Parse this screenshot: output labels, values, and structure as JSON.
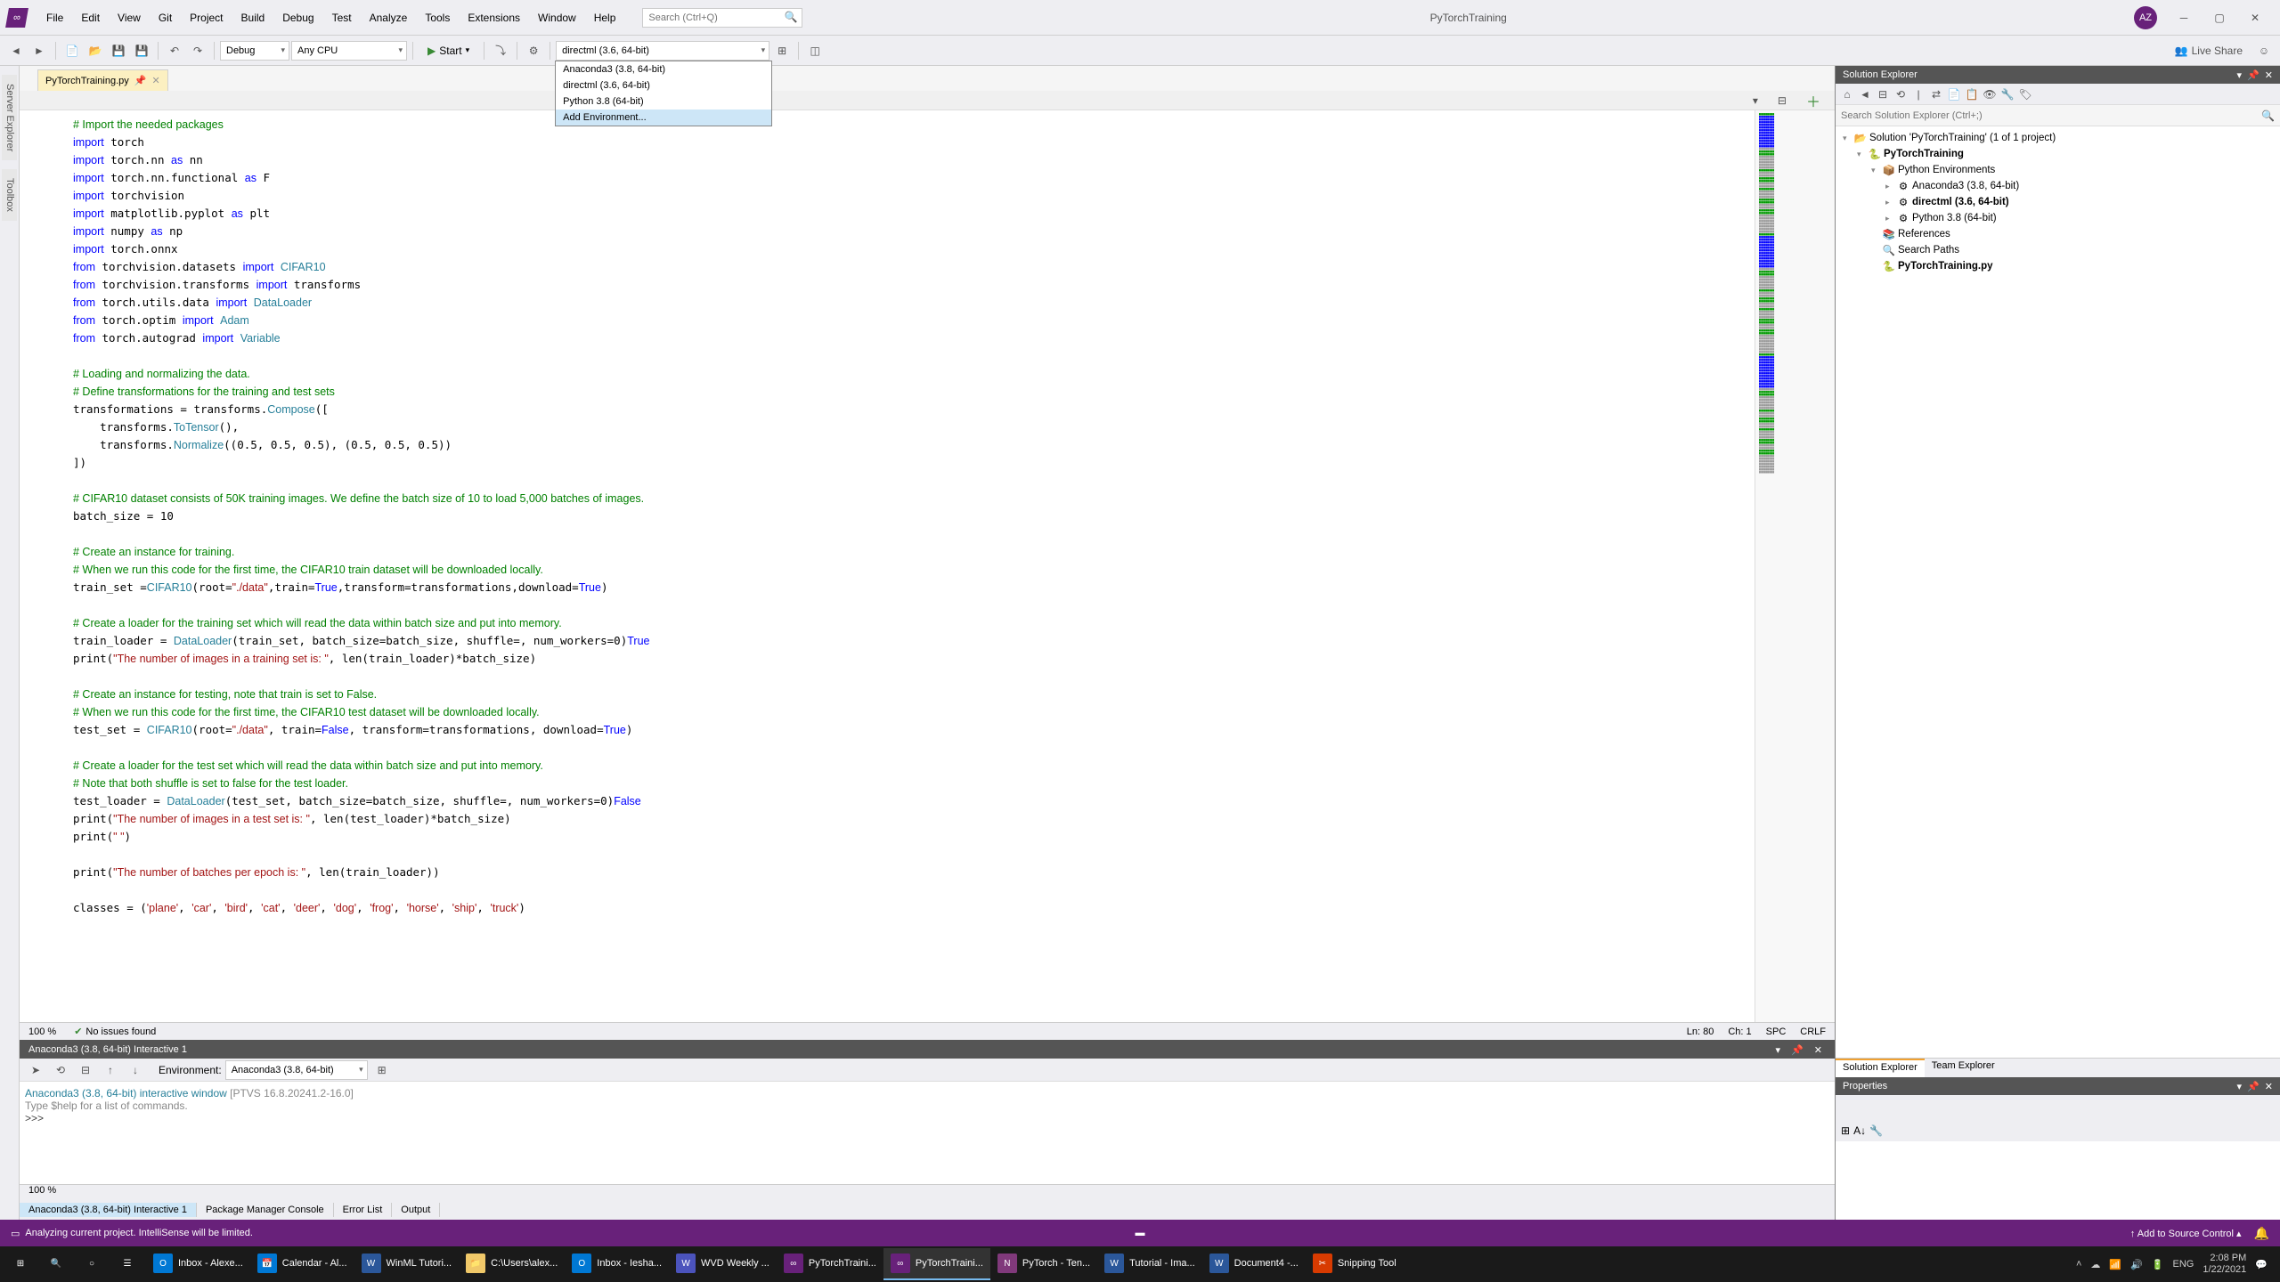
{
  "titlebar": {
    "menus": [
      "File",
      "Edit",
      "View",
      "Git",
      "Project",
      "Build",
      "Debug",
      "Test",
      "Analyze",
      "Tools",
      "Extensions",
      "Window",
      "Help"
    ],
    "search_placeholder": "Search (Ctrl+Q)",
    "solution_name": "PyTorchTraining",
    "user_initials": "AZ"
  },
  "toolbar": {
    "config": "Debug",
    "platform": "Any CPU",
    "start_label": "Start",
    "env_selected": "directml (3.6, 64-bit)",
    "env_options": [
      "Anaconda3 (3.8, 64-bit)",
      "directml (3.6, 64-bit)",
      "Python 3.8 (64-bit)",
      "Add Environment..."
    ],
    "live_share": "Live Share"
  },
  "left_tabs": [
    "Server Explorer",
    "Toolbox"
  ],
  "file_tab": {
    "name": "PyTorchTraining.py"
  },
  "code_lines": [
    {
      "t": "comment",
      "s": "# Import the needed packages"
    },
    {
      "t": "kw",
      "s": "import",
      "r": " torch"
    },
    {
      "t": "kw",
      "s": "import",
      "r": " torch.nn ",
      "kw2": "as",
      "r2": " nn"
    },
    {
      "t": "kw",
      "s": "import",
      "r": " torch.nn.functional ",
      "kw2": "as",
      "r2": " F"
    },
    {
      "t": "kw",
      "s": "import",
      "r": " torchvision"
    },
    {
      "t": "kw",
      "s": "import",
      "r": " matplotlib.pyplot ",
      "kw2": "as",
      "r2": " plt"
    },
    {
      "t": "kw",
      "s": "import",
      "r": " numpy ",
      "kw2": "as",
      "r2": " np"
    },
    {
      "t": "kw",
      "s": "import",
      "r": " torch.onnx"
    },
    {
      "t": "from",
      "s": "from",
      "m": " torchvision.datasets ",
      "kw2": "import",
      "r2": " ",
      "ty": "CIFAR10"
    },
    {
      "t": "from",
      "s": "from",
      "m": " torchvision.transforms ",
      "kw2": "import",
      "r2": " transforms"
    },
    {
      "t": "from",
      "s": "from",
      "m": " torch.utils.data ",
      "kw2": "import",
      "r2": " ",
      "ty": "DataLoader"
    },
    {
      "t": "from",
      "s": "from",
      "m": " torch.optim ",
      "kw2": "import",
      "r2": " ",
      "ty": "Adam"
    },
    {
      "t": "from",
      "s": "from",
      "m": " torch.autograd ",
      "kw2": "import",
      "r2": " ",
      "ty": "Variable"
    },
    {
      "t": "blank"
    },
    {
      "t": "comment",
      "s": "# Loading and normalizing the data."
    },
    {
      "t": "comment",
      "s": "# Define transformations for the training and test sets"
    },
    {
      "t": "assign",
      "l": "transformations = transforms.",
      "f": "Compose",
      "r": "(["
    },
    {
      "t": "indent",
      "l": "    transforms.",
      "f": "ToTensor",
      "r": "(),"
    },
    {
      "t": "indent",
      "l": "    transforms.",
      "f": "Normalize",
      "r": "((0.5, 0.5, 0.5), (0.5, 0.5, 0.5))"
    },
    {
      "t": "plain",
      "s": "])"
    },
    {
      "t": "blank"
    },
    {
      "t": "comment",
      "s": "# CIFAR10 dataset consists of 50K training images. We define the batch size of 10 to load 5,000 batches of images."
    },
    {
      "t": "plain",
      "s": "batch_size = 10"
    },
    {
      "t": "blank"
    },
    {
      "t": "comment",
      "s": "# Create an instance for training."
    },
    {
      "t": "comment",
      "s": "# When we run this code for the first time, the CIFAR10 train dataset will be downloaded locally."
    },
    {
      "t": "mixed",
      "s": "train_set =",
      "ty": "CIFAR10",
      "r": "(root=",
      "st": "\"./data\"",
      "r2": ",train=",
      "kw": "True",
      "r3": ",transform=transformations,download=",
      "kw2": "True",
      "r4": ")"
    },
    {
      "t": "blank"
    },
    {
      "t": "comment",
      "s": "# Create a loader for the training set which will read the data within batch size and put into memory."
    },
    {
      "t": "mixed",
      "s": "train_loader = ",
      "ty": "DataLoader",
      "r": "(train_set, batch_size=batch_size, shuffle=",
      "kw": "True",
      "r2": ", num_workers=0)"
    },
    {
      "t": "print",
      "s": "print(",
      "st": "\"The number of images in a training set is: \"",
      "r": ", len(train_loader)*batch_size)"
    },
    {
      "t": "blank"
    },
    {
      "t": "comment",
      "s": "# Create an instance for testing, note that train is set to False."
    },
    {
      "t": "comment",
      "s": "# When we run this code for the first time, the CIFAR10 test dataset will be downloaded locally."
    },
    {
      "t": "mixed",
      "s": "test_set = ",
      "ty": "CIFAR10",
      "r": "(root=",
      "st": "\"./data\"",
      "r2": ", train=",
      "kw": "False",
      "r3": ", transform=transformations, download=",
      "kw2": "True",
      "r4": ")"
    },
    {
      "t": "blank"
    },
    {
      "t": "comment",
      "s": "# Create a loader for the test set which will read the data within batch size and put into memory."
    },
    {
      "t": "comment",
      "s": "# Note that both shuffle is set to false for the test loader."
    },
    {
      "t": "mixed",
      "s": "test_loader = ",
      "ty": "DataLoader",
      "r": "(test_set, batch_size=batch_size, shuffle=",
      "kw": "False",
      "r2": ", num_workers=0)"
    },
    {
      "t": "print",
      "s": "print(",
      "st": "\"The number of images in a test set is: \"",
      "r": ", len(test_loader)*batch_size)"
    },
    {
      "t": "print",
      "s": "print(",
      "st": "\" \"",
      "r": ")"
    },
    {
      "t": "blank"
    },
    {
      "t": "print",
      "s": "print(",
      "st": "\"The number of batches per epoch is: \"",
      "r": ", len(train_loader))"
    },
    {
      "t": "blank"
    },
    {
      "t": "classes",
      "s": "classes = (",
      "items": [
        "'plane'",
        "'car'",
        "'bird'",
        "'cat'",
        "'deer'",
        "'dog'",
        "'frog'",
        "'horse'",
        "'ship'",
        "'truck'"
      ],
      "r": ")"
    }
  ],
  "code_footer": {
    "zoom": "100 %",
    "issues": "No issues found",
    "ln": "Ln: 80",
    "ch": "Ch: 1",
    "spc": "SPC",
    "crlf": "CRLF"
  },
  "interactive": {
    "header": "Anaconda3 (3.8, 64-bit) Interactive 1",
    "env_label": "Environment:",
    "env_value": "Anaconda3 (3.8, 64-bit)",
    "line1_a": "Anaconda3 (3.8, 64-bit) interactive window",
    "line1_b": " [PTVS 16.8.20241.2-16.0]",
    "line2": "Type $help for a list of commands.",
    "prompt": ">>>",
    "zoom": "100 %"
  },
  "bottom_tabs": [
    "Anaconda3 (3.8, 64-bit) Interactive 1",
    "Package Manager Console",
    "Error List",
    "Output"
  ],
  "solution_explorer": {
    "title": "Solution Explorer",
    "search_placeholder": "Search Solution Explorer (Ctrl+;)",
    "root": "Solution 'PyTorchTraining' (1 of 1 project)",
    "project": "PyTorchTraining",
    "env_header": "Python Environments",
    "envs": [
      "Anaconda3 (3.8, 64-bit)",
      "directml (3.6, 64-bit)",
      "Python 3.8 (64-bit)"
    ],
    "references": "References",
    "search_paths": "Search Paths",
    "file": "PyTorchTraining.py",
    "tabs": [
      "Solution Explorer",
      "Team Explorer"
    ]
  },
  "properties": {
    "title": "Properties"
  },
  "statusbar": {
    "msg": "Analyzing current project. IntelliSense will be limited.",
    "source_control": "Add to Source Control"
  },
  "taskbar": {
    "items": [
      {
        "icon": "O",
        "color": "#0078d4",
        "label": "Inbox - Alexe..."
      },
      {
        "icon": "📅",
        "color": "#0078d4",
        "label": "Calendar - Al..."
      },
      {
        "icon": "W",
        "color": "#2b579a",
        "label": "WinML Tutori..."
      },
      {
        "icon": "📁",
        "color": "#f0c869",
        "label": "C:\\Users\\alex..."
      },
      {
        "icon": "O",
        "color": "#0078d4",
        "label": "Inbox - Iesha..."
      },
      {
        "icon": "W",
        "color": "#4b53bc",
        "label": "WVD Weekly ..."
      },
      {
        "icon": "∞",
        "color": "#68217a",
        "label": "PyTorchTraini..."
      },
      {
        "icon": "∞",
        "color": "#68217a",
        "label": "PyTorchTraini...",
        "active": true
      },
      {
        "icon": "N",
        "color": "#80397b",
        "label": "PyTorch - Ten..."
      },
      {
        "icon": "W",
        "color": "#2b579a",
        "label": "Tutorial - Ima..."
      },
      {
        "icon": "W",
        "color": "#2b579a",
        "label": "Document4 -..."
      },
      {
        "icon": "✂",
        "color": "#d83b01",
        "label": "Snipping Tool"
      }
    ],
    "lang": "ENG",
    "time": "2:08 PM",
    "date": "1/22/2021"
  }
}
